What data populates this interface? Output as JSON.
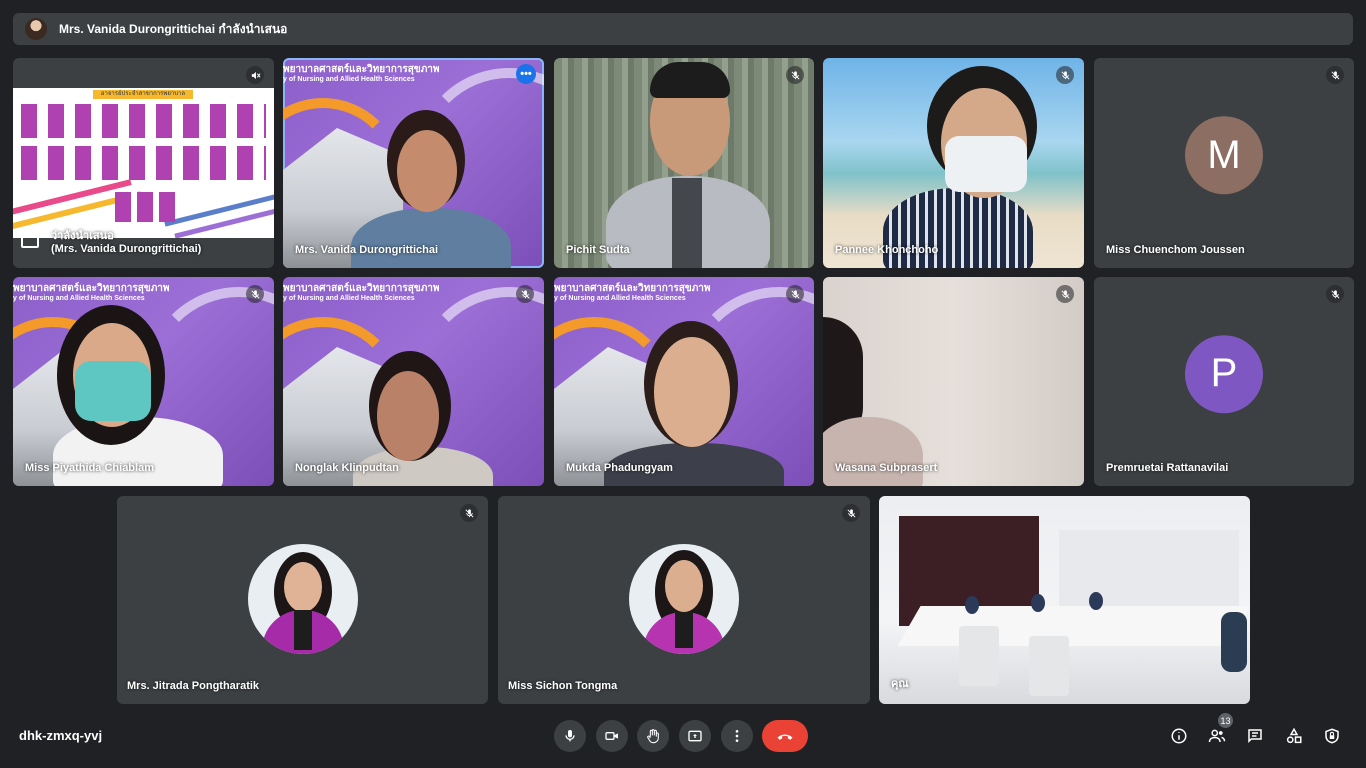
{
  "presenting_banner": "Mrs. Vanida Durongrittichai กำลังนำเสนอ",
  "meeting_code": "dhk-zmxq-yvj",
  "participant_count": "13",
  "background_header_thai": "พยาบาลศาสตร์และวิทยาการสุขภาพ",
  "background_header_en": "y of Nursing and Allied Health Sciences",
  "presentation_title": "อาจารย์ประจำสาขาการพยาบาล",
  "tiles": [
    {
      "id": "presentation",
      "label_line1": "ว่าลังนำเสนอ",
      "label_line2": "(Mrs. Vanida Durongrittichai)"
    },
    {
      "id": "vanida",
      "label": "Mrs. Vanida Durongrittichai"
    },
    {
      "id": "pichit",
      "label": "Pichit Sudta"
    },
    {
      "id": "pannee",
      "label": "Pannee Khonchoho"
    },
    {
      "id": "chuenchom",
      "label": "Miss Chuenchom Joussen",
      "initial": "M",
      "color": "#8d6e63"
    },
    {
      "id": "piyathida",
      "label": "Miss Piyathida Chiablam"
    },
    {
      "id": "nonglak",
      "label": "Nonglak Klinpudtan"
    },
    {
      "id": "mukda",
      "label": "Mukda Phadungyam"
    },
    {
      "id": "wasana",
      "label": "Wasana Subprasert"
    },
    {
      "id": "premruetai",
      "label": "Premruetai Rattanavilai",
      "initial": "P",
      "color": "#7e57c2"
    },
    {
      "id": "jitrada",
      "label": "Mrs. Jitrada Pongtharatik"
    },
    {
      "id": "sichon",
      "label": "Miss Sichon Tongma"
    },
    {
      "id": "room",
      "label": "คุณ"
    }
  ]
}
